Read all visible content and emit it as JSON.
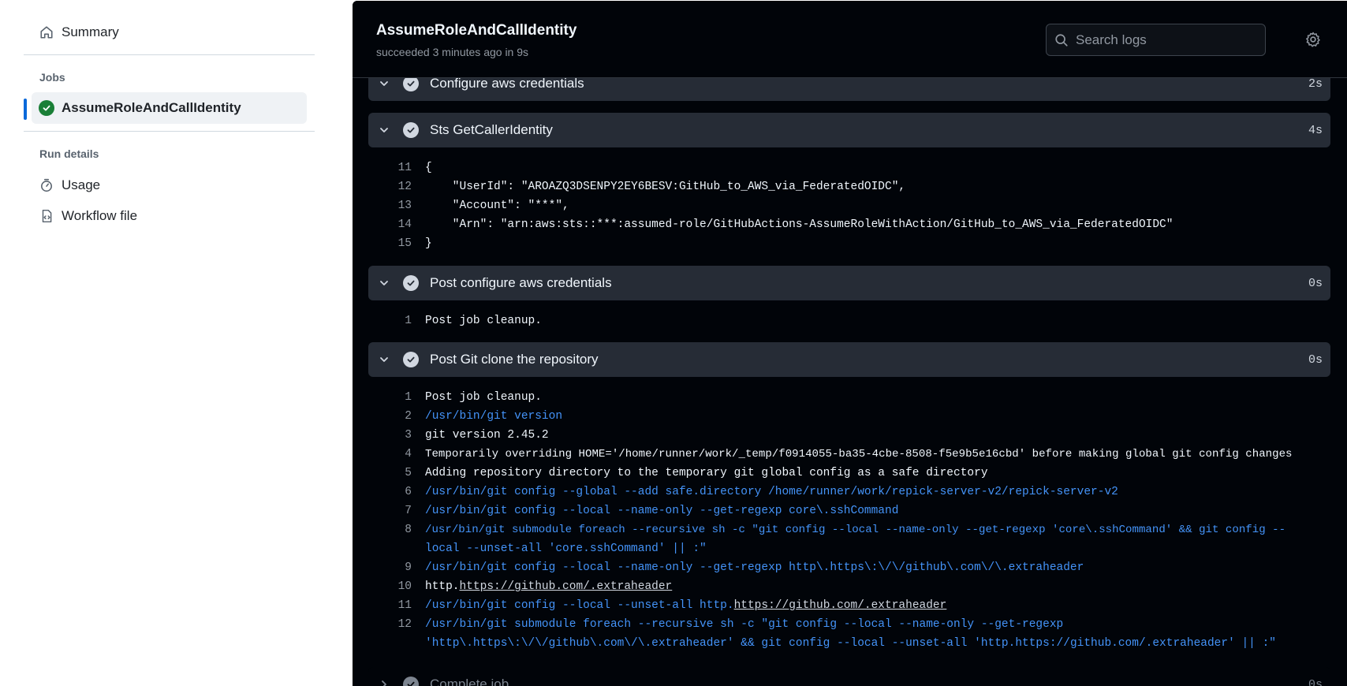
{
  "sidebar": {
    "summary_label": "Summary",
    "jobs_heading": "Jobs",
    "job_label": "AssumeRoleAndCallIdentity",
    "run_details_heading": "Run details",
    "usage_label": "Usage",
    "workflow_file_label": "Workflow file"
  },
  "header": {
    "title": "AssumeRoleAndCallIdentity",
    "subtitle": "succeeded 3 minutes ago in 9s",
    "search_placeholder": "Search logs"
  },
  "steps": {
    "configure": {
      "name": "Configure aws credentials",
      "duration": "2s"
    },
    "sts": {
      "name": "Sts GetCallerIdentity",
      "duration": "4s",
      "lines": [
        {
          "n": "11",
          "t": "{"
        },
        {
          "n": "12",
          "t": "    \"UserId\": \"AROAZQ3DSENPY2EY6BESV:GitHub_to_AWS_via_FederatedOIDC\","
        },
        {
          "n": "13",
          "t": "    \"Account\": \"***\","
        },
        {
          "n": "14",
          "t": "    \"Arn\": \"arn:aws:sts::***:assumed-role/GitHubActions-AssumeRoleWithAction/GitHub_to_AWS_via_FederatedOIDC\""
        },
        {
          "n": "15",
          "t": "}"
        }
      ]
    },
    "post_configure": {
      "name": "Post configure aws credentials",
      "duration": "0s",
      "lines": [
        {
          "n": "1",
          "t": "Post job cleanup."
        }
      ]
    },
    "post_git": {
      "name": "Post Git clone the repository",
      "duration": "0s",
      "lines": [
        {
          "n": "1",
          "t": "Post job cleanup."
        },
        {
          "n": "2",
          "t": "/usr/bin/git version"
        },
        {
          "n": "3",
          "t": "git version 2.45.2"
        },
        {
          "n": "4",
          "t": "Temporarily overriding HOME='/home/runner/work/_temp/f0914055-ba35-4cbe-8508-f5e9b5e16cbd' before making global git config changes"
        },
        {
          "n": "5",
          "t": "Adding repository directory to the temporary git global config as a safe directory"
        },
        {
          "n": "6",
          "t": "/usr/bin/git config --global --add safe.directory /home/runner/work/repick-server-v2/repick-server-v2"
        },
        {
          "n": "7",
          "t": "/usr/bin/git config --local --name-only --get-regexp core\\.sshCommand"
        },
        {
          "n": "8",
          "t": "/usr/bin/git submodule foreach --recursive sh -c \"git config --local --name-only --get-regexp 'core\\.sshCommand' && git config --",
          "t2": "local --unset-all 'core.sshCommand' || :\""
        },
        {
          "n": "9",
          "t": "/usr/bin/git config --local --name-only --get-regexp http\\.https\\:\\/\\/github\\.com\\/\\.extraheader"
        },
        {
          "n": "10",
          "pre": "http.",
          "link": "https://github.com/.extraheader"
        },
        {
          "n": "11",
          "pre": "/usr/bin/git config --local --unset-all http.",
          "link": "https://github.com/.extraheader"
        },
        {
          "n": "12",
          "t": "/usr/bin/git submodule foreach --recursive sh -c \"git config --local --name-only --get-regexp",
          "t2pre": "'http\\.https\\:\\/\\/github\\.com\\/\\.extraheader' && git config --local --unset-all 'http.",
          "t2link": "https://github.com/.extraheader",
          "t2post": "' || :\""
        }
      ]
    },
    "complete": {
      "name": "Complete job",
      "duration": "0s"
    }
  }
}
